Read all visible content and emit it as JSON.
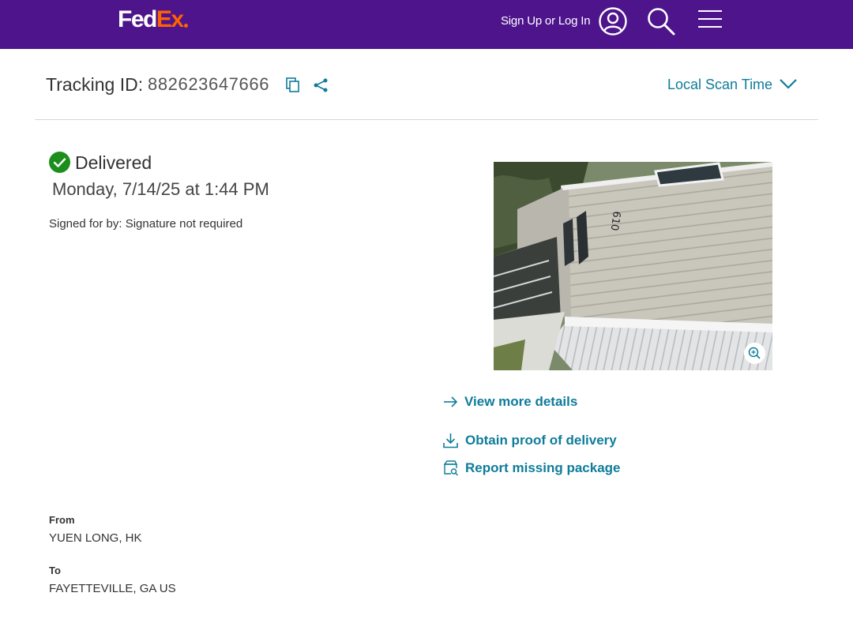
{
  "header": {
    "logo_fed": "Fed",
    "logo_ex": "Ex",
    "sign_in_label": "Sign Up or Log In",
    "icons": {
      "user": "user-icon",
      "search": "search-icon",
      "menu": "menu-icon"
    },
    "brand_color": "#4d148c",
    "logo_accent": "#ff6200"
  },
  "tracking": {
    "label": "Tracking ID:",
    "number": "882623647666",
    "copy_icon": "copy-icon",
    "share_icon": "share-icon",
    "scan_time_label": "Local Scan Time",
    "scan_time_icon": "chevron-down-icon"
  },
  "status": {
    "icon": "check-circle-icon",
    "text": "Delivered",
    "date": "Monday, 7/14/25 at 1:44 PM",
    "signed_for": "Signed for by: Signature not required",
    "status_color": "#1c8e1c"
  },
  "photo": {
    "house_number": "610",
    "zoom_icon": "zoom-in-icon"
  },
  "actions": {
    "view_details": "View more details",
    "proof_of_delivery": "Obtain proof of delivery",
    "report_missing": "Report missing package",
    "link_color": "#0e7c9a"
  },
  "shipment": {
    "from_label": "From",
    "from_value": "YUEN LONG, HK",
    "to_label": "To",
    "to_value": "FAYETTEVILLE, GA US"
  }
}
